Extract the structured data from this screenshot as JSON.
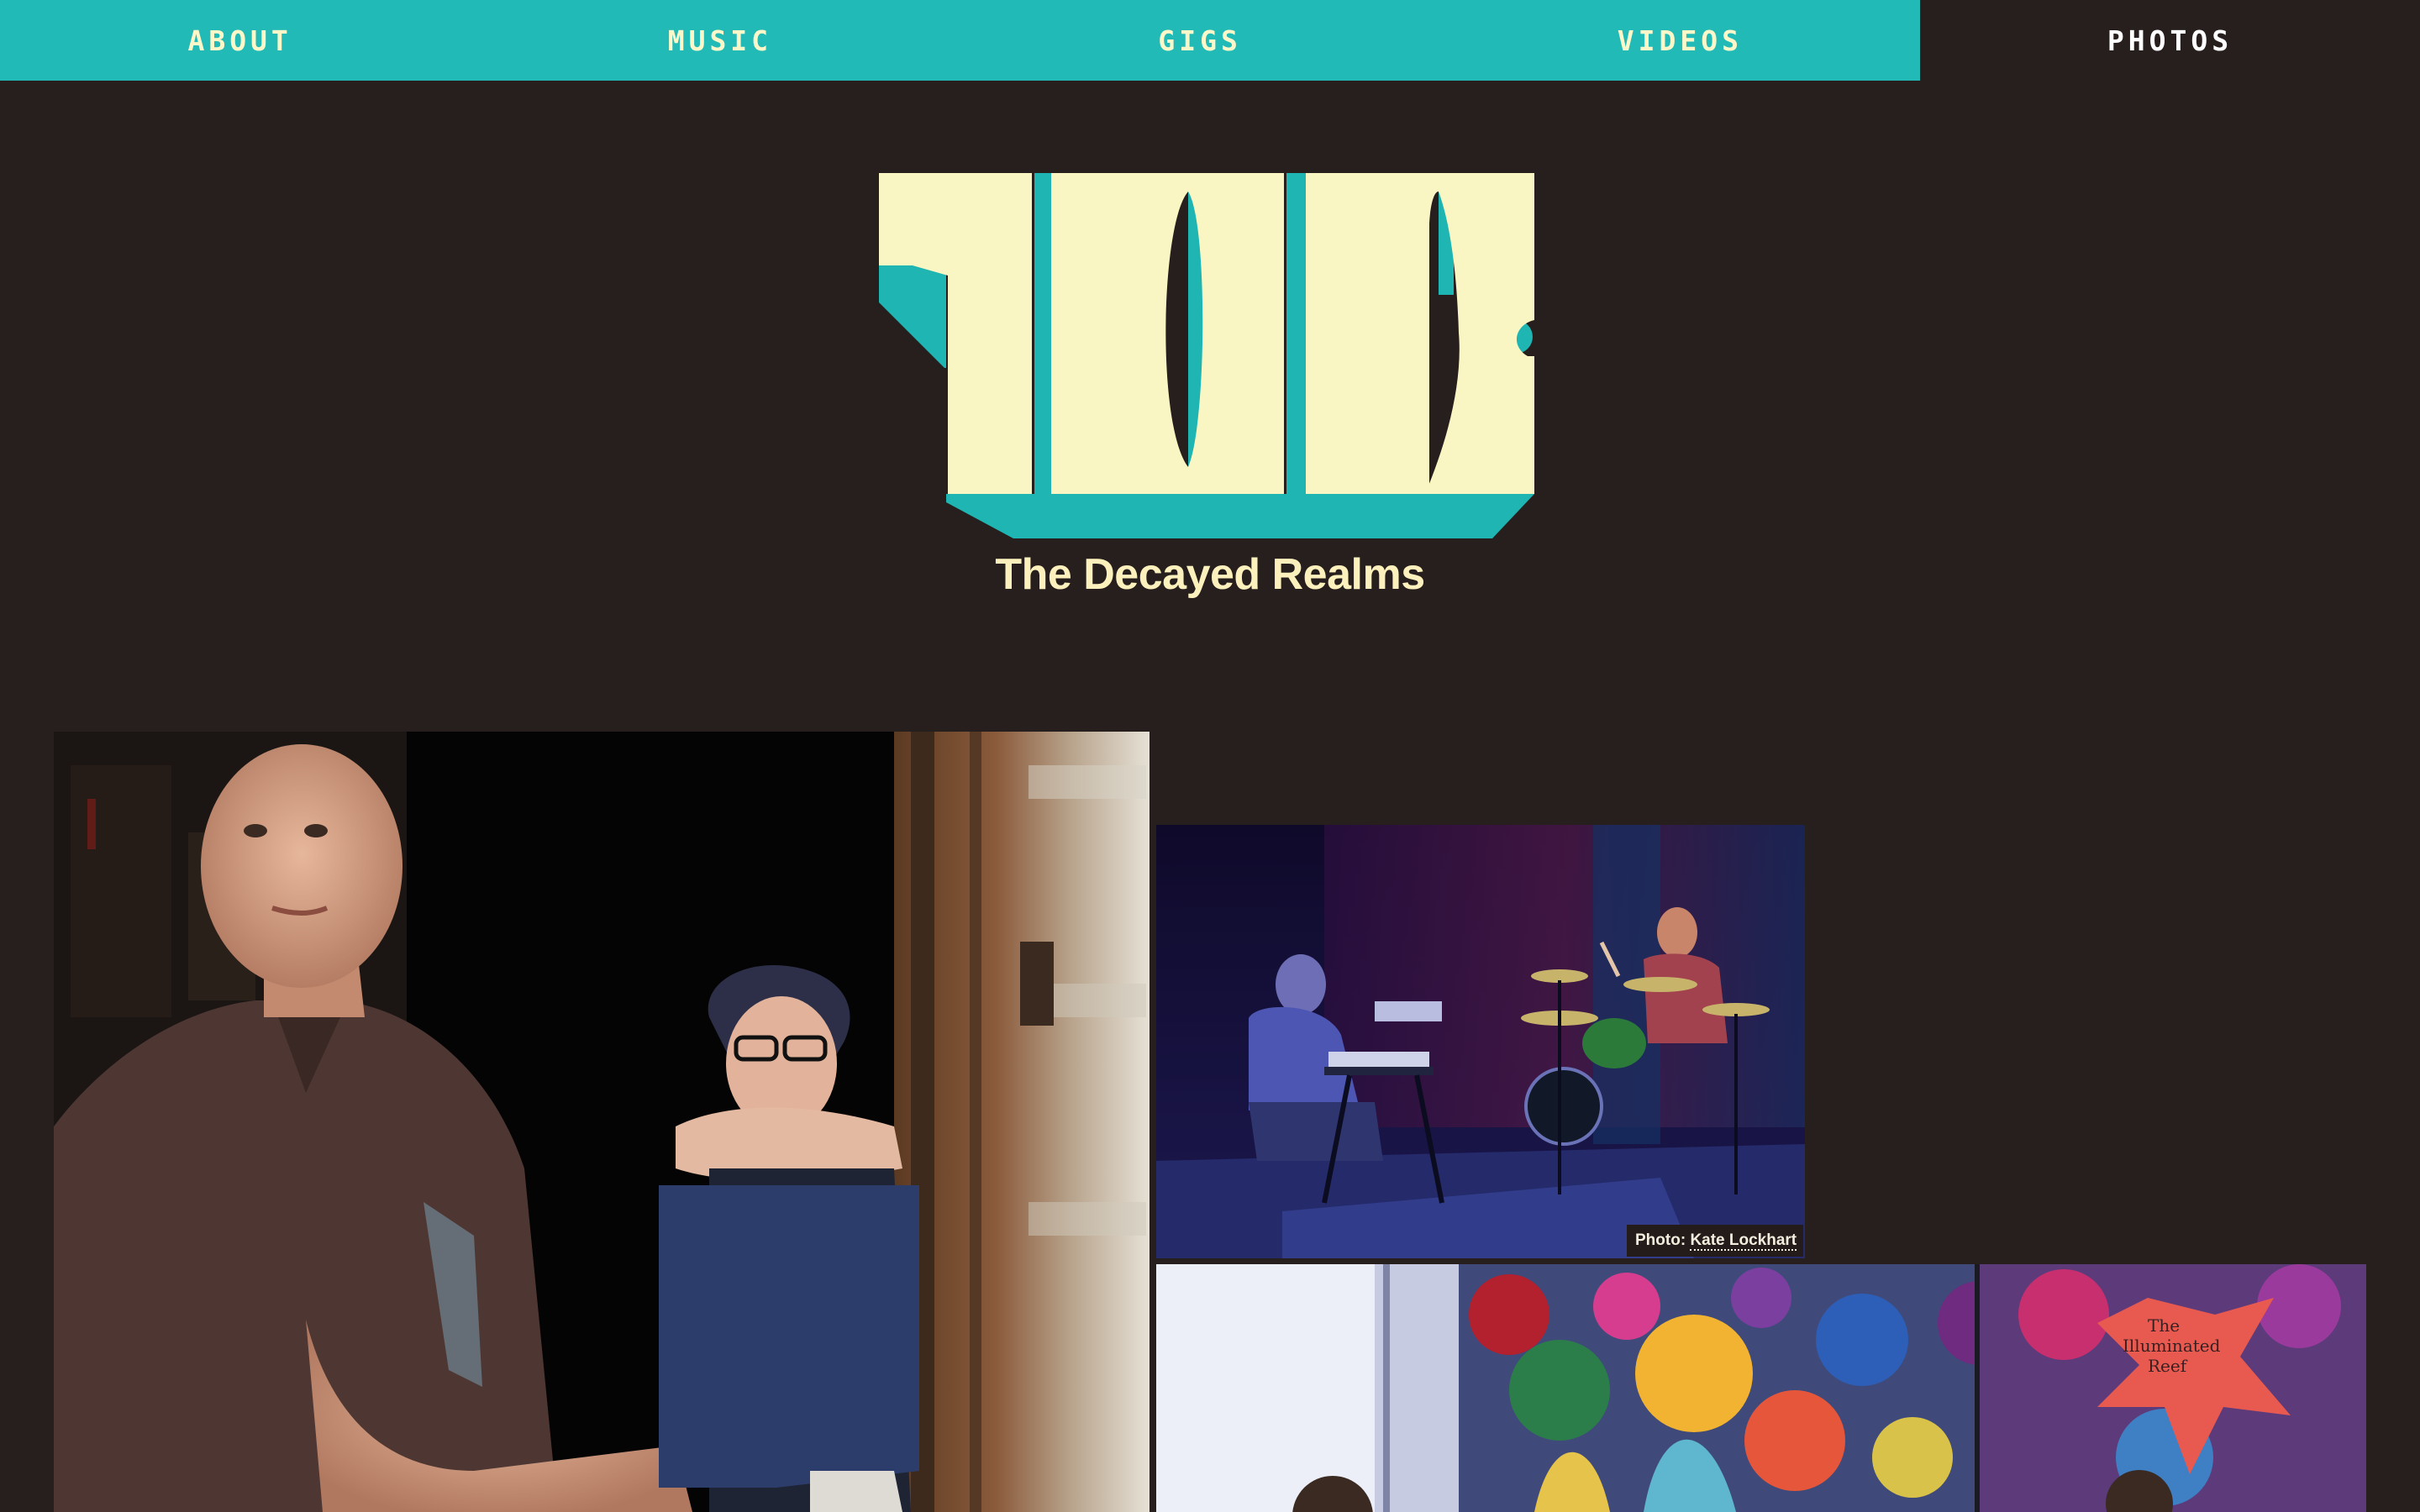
{
  "nav": {
    "items": [
      {
        "label": "ABOUT"
      },
      {
        "label": "MUSIC"
      },
      {
        "label": "GIGS"
      },
      {
        "label": "VIDEOS"
      }
    ],
    "active": {
      "label": "PHOTOS"
    }
  },
  "logo": {
    "letters": "TDR",
    "band_name": "The Decayed Realms"
  },
  "photos": {
    "credit_prefix": "Photo: ",
    "credit_name": "Kate Lockhart",
    "mural_sign": [
      "The",
      "Illuminated",
      "Reef"
    ]
  },
  "colors": {
    "background": "#271f1d",
    "accent_teal": "#22bab7",
    "cream": "#fcf7c8"
  }
}
